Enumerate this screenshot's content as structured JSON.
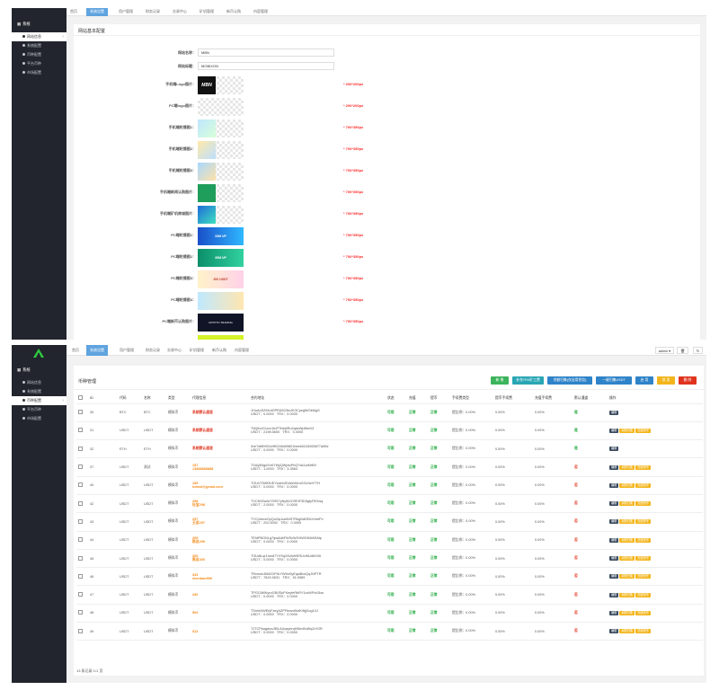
{
  "top": {
    "tabs": [
      "首页",
      "系统设置",
      "用户管理",
      "财务记录",
      "交易中心",
      "矿机管理",
      "新币认购",
      "内容管理"
    ],
    "section_title": "网站基本配置",
    "fields": [
      {
        "label": "网站名称：",
        "value": "MBN"
      },
      {
        "label": "网站标题：",
        "value": "MOBIXON"
      }
    ],
    "images": [
      {
        "label": "手机端Logo图片：",
        "size": "* 200*200px"
      },
      {
        "label": "PC端logo图片：",
        "size": "* 200*200px"
      },
      {
        "label": "手机端轮播图1：",
        "size": "* 700*350px"
      },
      {
        "label": "手机端轮播图2：",
        "size": "* 700*350px"
      },
      {
        "label": "手机端轮播图3：",
        "size": "* 700*350px"
      },
      {
        "label": "手机端新闻认购图片：",
        "size": "* 700*350px"
      },
      {
        "label": "手机端矿机商城图片：",
        "size": "* 700*350px"
      },
      {
        "label": "PC端轮播图1：",
        "size": "* 700*350px"
      },
      {
        "label": "PC端轮播图2：",
        "size": "* 700*350px"
      },
      {
        "label": "PC端轮播图3：",
        "size": "* 700*350px"
      },
      {
        "label": "PC端轮播图4：",
        "size": "* 700*350px"
      },
      {
        "label": "PC端新币认购图片：",
        "size": "* 700*350px"
      }
    ],
    "banner_texts": [
      "MBN",
      "33M UP",
      "35M UP",
      "200 USDT",
      "CRYPTO TRADING"
    ]
  },
  "sidebar": {
    "section": "系统",
    "items": [
      "网站信息",
      "系统配置",
      "币种配置",
      "平台币种",
      "市场配置"
    ]
  },
  "bottom": {
    "tabs": [
      "首页",
      "系统设置",
      "用户管理",
      "财务记录",
      "交易中心",
      "矿机管理",
      "新币认购",
      "内容管理"
    ],
    "user": "admin",
    "panel_title": "币种管理",
    "actions": [
      "新 增",
      "补充TRX矿工费",
      "余额归集(仅自用钱包)",
      "一键归集USDT",
      "启 用",
      "禁 用",
      "删 除"
    ],
    "headers": [
      "ID",
      "代码",
      "名称",
      "类型",
      "代理信息",
      "合约地址",
      "状态",
      "充值",
      "提币",
      "手续费类型",
      "提币手续费",
      "充值手续费",
      "默认通道",
      "操作"
    ],
    "rows": [
      {
        "id": "30",
        "code": "BTC",
        "name": "BTC",
        "type": "模拟币",
        "agent1": "系统默认通道",
        "agent2": "",
        "addr": "1HuAoSZMLbDPRA9C5toJK3Cyeg5eSkMgG",
        "usdt": "USDT：0.0000",
        "trx": "TRX：0.0000",
        "status": "可用",
        "dep": "正常",
        "wd": "正常",
        "feetype": "提比例：0.00%",
        "wdfee": "0.00%",
        "depfee": "0.00%",
        "def": "是",
        "ops": [
          "编辑"
        ]
      },
      {
        "id": "31",
        "code": "USDT",
        "name": "USDT",
        "type": "模拟币",
        "agent1": "系统默认通道",
        "agent2": "",
        "addr": "TWjXxvD1uxr1tuPTbfq9Ru2qdcWpBiwVZ",
        "usdt": "USDT：2198.5600",
        "trx": "TRX：0.0000",
        "status": "可用",
        "dep": "正常",
        "wd": "正常",
        "feetype": "提比例：0.00%",
        "wdfee": "0.00%",
        "depfee": "0.00%",
        "def": "是",
        "ops": [
          "编辑",
          "余额归集",
          "充值账号"
        ]
      },
      {
        "id": "32",
        "code": "ETH",
        "name": "ETH",
        "type": "模拟币",
        "agent1": "系统默认通道",
        "agent2": "",
        "addr": "0xe7d8f0901e9f0246d09801bbeb0243065877a59d",
        "usdt": "USDT：0.0000",
        "trx": "TRX：0.0000",
        "status": "可用",
        "dep": "正常",
        "wd": "正常",
        "feetype": "提比例：0.00%",
        "wdfee": "0.00%",
        "depfee": "0.00%",
        "def": "是",
        "ops": [
          "编辑"
        ]
      },
      {
        "id": "37",
        "code": "USDT",
        "name": "测试",
        "type": "模拟币",
        "agent1": "187",
        "agent2": "13888888888",
        "addr": "TXAy5NgoSxKYbfyQWptoPhQYdc1wMrBV",
        "usdt": "USDT：1.0000",
        "trx": "TRX：3.3564",
        "status": "可用",
        "dep": "正常",
        "wd": "正常",
        "feetype": "提比例：0.00%",
        "wdfee": "0.00%",
        "depfee": "0.00%",
        "def": "否",
        "ops": [
          "编辑",
          "余额归集",
          "充值账号"
        ]
      },
      {
        "id": "40",
        "code": "USDT",
        "name": "USDT",
        "type": "模拟币",
        "agent1": "185",
        "agent2": "hdmsf@gmail.com",
        "addr": "TGUV7D8EfUEYwzbhSVAhM4mGGz3xH77H",
        "usdt": "USDT：0.0000",
        "trx": "TRX：0.0000",
        "status": "可用",
        "dep": "正常",
        "wd": "正常",
        "feetype": "提比例：0.00%",
        "wdfee": "0.00%",
        "depfee": "0.00%",
        "def": "否",
        "ops": [
          "编辑",
          "余额归集",
          "充值账号"
        ]
      },
      {
        "id": "42",
        "code": "USDT",
        "name": "USDT",
        "type": "模拟币",
        "agent1": "298",
        "agent2": "杜宝298",
        "addr": "TVCN9ZwAr7S9S7yNqNXCREiF3D5gfyF5Gwq",
        "usdt": "USDT：2.0000",
        "trx": "TRX：0.0000",
        "status": "可用",
        "dep": "正常",
        "wd": "正常",
        "feetype": "提比例：0.00%",
        "wdfee": "0.00%",
        "depfee": "0.00%",
        "def": "否",
        "ops": [
          "编辑",
          "余额归集",
          "充值账号"
        ]
      },
      {
        "id": "43",
        "code": "USDT",
        "name": "USDT",
        "type": "模拟币",
        "agent1": "297",
        "agent2": "王总297",
        "addr": "TYCpheveGyQo2qUcaXbR7RkgNdDEkXr4ntPv",
        "usdt": "USDT：202.5092",
        "trx": "TRX：0.0000",
        "status": "可用",
        "dep": "正常",
        "wd": "正常",
        "feetype": "提比例：0.00%",
        "wdfee": "0.00%",
        "depfee": "0.00%",
        "def": "否",
        "ops": [
          "编辑",
          "余额归集",
          "充值账号"
        ]
      },
      {
        "id": "44",
        "code": "USDT",
        "name": "USDT",
        "type": "模拟币",
        "agent1": "299",
        "agent2": "陈总299",
        "addr": "TEhtPBGNLg7qwAdbFWSzWGHWGK6tK5Atp",
        "usdt": "USDT：0.0000",
        "trx": "TRX：0.0000",
        "status": "可用",
        "dep": "正常",
        "wd": "正常",
        "feetype": "提比例：0.00%",
        "wdfee": "0.00%",
        "depfee": "0.00%",
        "def": "否",
        "ops": [
          "编辑",
          "余额归集",
          "充值账号"
        ]
      },
      {
        "id": "45",
        "code": "USDT",
        "name": "USDT",
        "type": "模拟币",
        "agent1": "300",
        "agent2": "陈总300",
        "addr": "TGUdtLqr1mnd7YVSqXDzWeERUvWUd6Xh5",
        "usdt": "USDT：0.0000",
        "trx": "TRX：0.0000",
        "status": "可用",
        "dep": "正常",
        "wd": "正常",
        "feetype": "提比例：0.00%",
        "wdfee": "0.00%",
        "depfee": "0.00%",
        "def": "否",
        "ops": [
          "编辑",
          "余额归集",
          "充值账号"
        ]
      },
      {
        "id": "46",
        "code": "USDT",
        "name": "USDT",
        "type": "模拟币",
        "agent1": "333",
        "agent2": "shenbao999",
        "addr": "TRxmwLB6tCDFNrYWHz9yEqwBveQqJNPTR",
        "usdt": "USDT：7815.9631",
        "trx": "TRX：51.0589",
        "status": "可用",
        "dep": "正常",
        "wd": "正常",
        "feetype": "提比例：0.00%",
        "wdfee": "0.00%",
        "depfee": "0.00%",
        "def": "否",
        "ops": [
          "编辑",
          "余额归集",
          "充值账号"
        ]
      },
      {
        "id": "47",
        "code": "USDT",
        "name": "USDT",
        "type": "模拟币",
        "agent1": "430",
        "agent2": "",
        "addr": "TPGC8MKyroGBVEpFKeyfeRbRY1cxWPch3ba",
        "usdt": "USDT：0.0000",
        "trx": "TRX：0.0000",
        "status": "可用",
        "dep": "正常",
        "wd": "正常",
        "feetype": "提比例：0.00%",
        "wdfee": "0.00%",
        "depfee": "0.00%",
        "def": "否",
        "ops": [
          "编辑",
          "余额归集",
          "充值账号"
        ]
      },
      {
        "id": "48",
        "code": "USDT",
        "name": "USDT",
        "type": "模拟币",
        "agent1": "504",
        "agent2": "",
        "addr": "TSnhrNWEfyFzeyAZPFbnsvt5otK9tjjXog1XJ",
        "usdt": "USDT：0.0000",
        "trx": "TRX：0.0000",
        "status": "可用",
        "dep": "正常",
        "wd": "正常",
        "feetype": "提比例：0.00%",
        "wdfee": "0.00%",
        "depfee": "0.00%",
        "def": "否",
        "ops": [
          "编辑",
          "余额归集",
          "充值账号"
        ]
      },
      {
        "id": "49",
        "code": "USDT",
        "name": "USDT",
        "type": "模拟币",
        "agent1": "513",
        "agent2": "",
        "addr": "TJTCPkagdcru3BLAUqsyhrqHNed5uWqJrVGR",
        "usdt": "USDT：0.0000",
        "trx": "TRX：0.0000",
        "status": "可用",
        "dep": "正常",
        "wd": "正常",
        "feetype": "提比例：0.00%",
        "wdfee": "0.00%",
        "depfee": "0.00%",
        "def": "否",
        "ops": [
          "编辑",
          "余额归集",
          "充值账号"
        ]
      }
    ],
    "footer": "13 条记录 1/1 页"
  },
  "colors": {
    "sidebar": "#22252d",
    "accent_tab": "#5fa3df",
    "red": "#e0341f",
    "green": "#1fa83b",
    "orange": "#f28a1a"
  }
}
